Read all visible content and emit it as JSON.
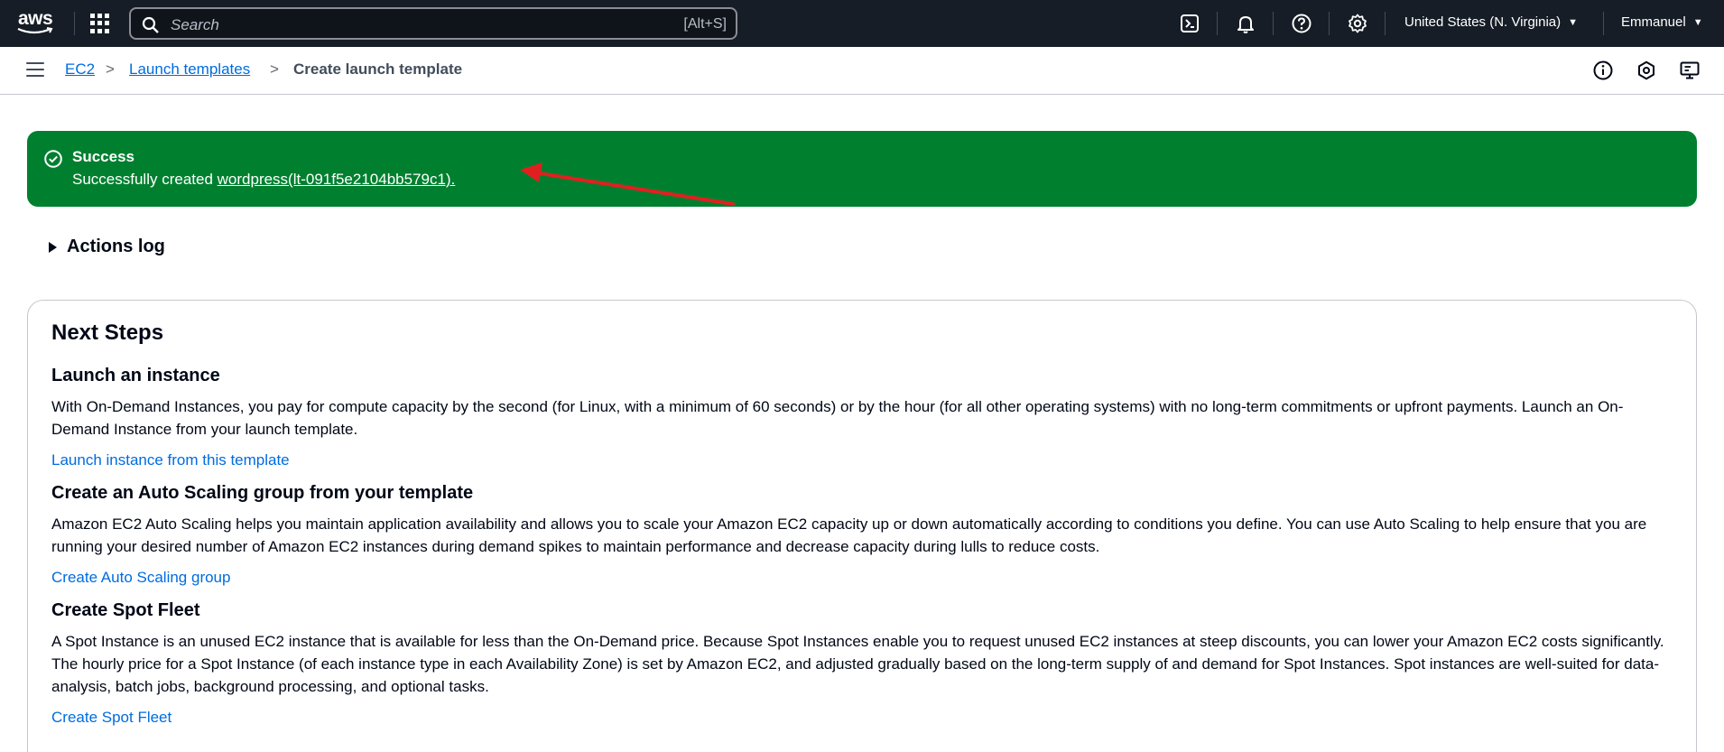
{
  "topnav": {
    "logo_text": "aws",
    "search_placeholder": "Search",
    "search_shortcut": "[Alt+S]",
    "icons": [
      "grid-icon",
      "cloudshell-icon",
      "bell-icon",
      "help-icon",
      "gear-icon"
    ],
    "region": "United States (N. Virginia)",
    "user": "Emmanuel"
  },
  "breadcrumb": {
    "items": [
      "EC2",
      "Launch templates",
      "Create launch template"
    ],
    "right_icons": [
      "info-icon",
      "settings-hex-icon",
      "feedback-icon"
    ]
  },
  "flash": {
    "type": "success",
    "title": "Success",
    "message_prefix": "Successfully created ",
    "link_text": "wordpress(lt-091f5e2104bb579c1).",
    "bg_color": "#00802f"
  },
  "actions_log": {
    "label": "Actions log"
  },
  "next_steps": {
    "title": "Next Steps",
    "sections": [
      {
        "heading": "Launch an instance",
        "text": "With On-Demand Instances, you pay for compute capacity by the second (for Linux, with a minimum of 60 seconds) or by the hour (for all other operating systems) with no long-term commitments or upfront payments. Launch an On-Demand Instance from your launch template.",
        "link": "Launch instance from this template"
      },
      {
        "heading": "Create an Auto Scaling group from your template",
        "text": "Amazon EC2 Auto Scaling helps you maintain application availability and allows you to scale your Amazon EC2 capacity up or down automatically according to conditions you define. You can use Auto Scaling to help ensure that you are running your desired number of Amazon EC2 instances during demand spikes to maintain performance and decrease capacity during lulls to reduce costs.",
        "link": "Create Auto Scaling group"
      },
      {
        "heading": "Create Spot Fleet",
        "text": "A Spot Instance is an unused EC2 instance that is available for less than the On-Demand price. Because Spot Instances enable you to request unused EC2 instances at steep discounts, you can lower your Amazon EC2 costs significantly. The hourly price for a Spot Instance (of each instance type in each Availability Zone) is set by Amazon EC2, and adjusted gradually based on the long-term supply of and demand for Spot Instances. Spot instances are well-suited for data-analysis, batch jobs, background processing, and optional tasks.",
        "link": "Create Spot Fleet"
      }
    ]
  },
  "colors": {
    "nav_bg": "#161d26",
    "link": "#006ce0",
    "annotation_arrow": "#e02020"
  }
}
